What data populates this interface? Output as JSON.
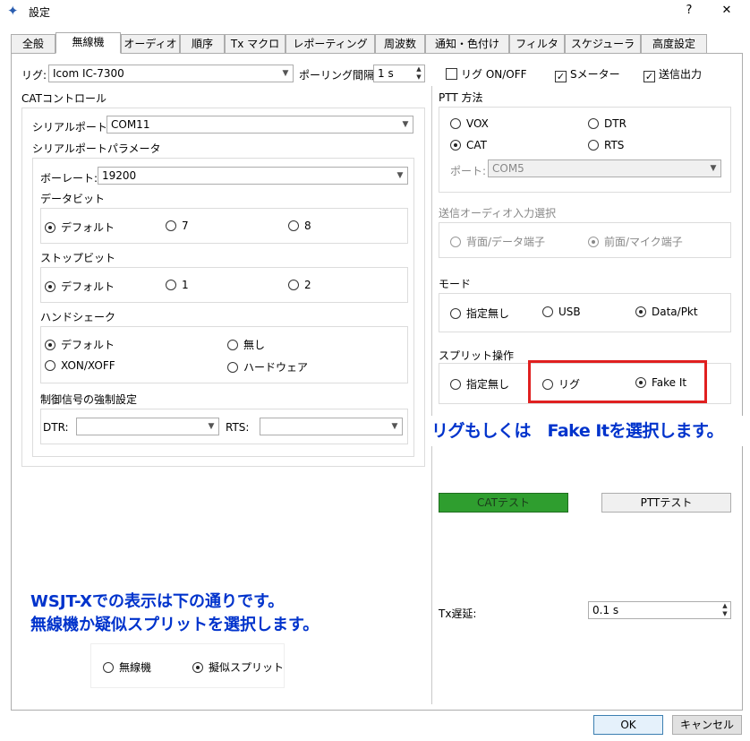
{
  "window": {
    "title": "設定",
    "help_label": "?",
    "close_label": "✕",
    "icon": "radio-star-icon"
  },
  "tabs": [
    {
      "label": "全般"
    },
    {
      "label": "無線機"
    },
    {
      "label": "オーディオ"
    },
    {
      "label": "順序"
    },
    {
      "label": "Tx マクロ"
    },
    {
      "label": "レポーティング"
    },
    {
      "label": "周波数"
    },
    {
      "label": "通知・色付け"
    },
    {
      "label": "フィルタ"
    },
    {
      "label": "スケジューラ"
    },
    {
      "label": "高度設定"
    }
  ],
  "top_row": {
    "rig_label": "リグ:",
    "rig_value": "Icom IC-7300",
    "poll_label": "ポーリング間隔:",
    "poll_value": "1 s",
    "rig_onoff": "リグ ON/OFF",
    "smeter": "Sメーター",
    "tx_power": "送信出力",
    "rig_onoff_checked": false,
    "smeter_checked": true,
    "tx_power_checked": true
  },
  "cat": {
    "title": "CATコントロール",
    "serial_port_label": "シリアルポート:",
    "serial_port_value": "COM11",
    "serial_params_title": "シリアルポートパラメータ",
    "baud_label": "ボーレート:",
    "baud_value": "19200",
    "data_bits_title": "データビット",
    "data_bits": [
      "デフォルト",
      "7",
      "8"
    ],
    "stop_bits_title": "ストップビット",
    "stop_bits": [
      "デフォルト",
      "1",
      "2"
    ],
    "handshake_title": "ハンドシェーク",
    "handshake": [
      "デフォルト",
      "無し",
      "XON/XOFF",
      "ハードウェア"
    ],
    "force_title": "制御信号の強制設定",
    "dtr_label": "DTR:",
    "rts_label": "RTS:"
  },
  "ptt": {
    "title": "PTT 方法",
    "vox": "VOX",
    "dtr": "DTR",
    "cat": "CAT",
    "rts": "RTS",
    "port_label": "ポート:",
    "port_value": "COM5"
  },
  "audio_input": {
    "title": "送信オーディオ入力選択",
    "rear": "背面/データ端子",
    "front": "前面/マイク端子"
  },
  "mode": {
    "title": "モード",
    "none": "指定無し",
    "usb": "USB",
    "data": "Data/Pkt"
  },
  "split": {
    "title": "スプリット操作",
    "none": "指定無し",
    "rig": "リグ",
    "fake": "Fake It"
  },
  "annotation_right": "リグもしくは　Fake Itを選択します。",
  "test_buttons": {
    "cat_test": "CATテスト",
    "ptt_test": "PTTテスト",
    "cat_test_color": "#2f9e2f"
  },
  "tx_delay": {
    "label": "Tx遅延:",
    "value": "0.1 s"
  },
  "annotation_left": {
    "line1": "WSJT-Xでの表示は下の通りです。",
    "line2": "無線機か疑似スプリットを選択します。"
  },
  "inset": {
    "option1": "無線機",
    "option2": "擬似スプリット"
  },
  "footer": {
    "ok": "OK",
    "cancel": "キャンセル"
  },
  "colors": {
    "highlight_border": "#e02020",
    "annotation_text": "#0033cc"
  }
}
